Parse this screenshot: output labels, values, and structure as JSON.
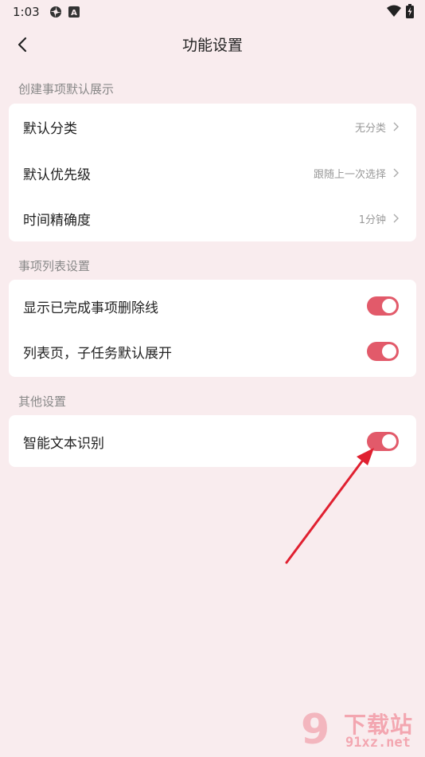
{
  "status_bar": {
    "time": "1:03",
    "icons": [
      "settings-flower-icon",
      "a-badge-icon"
    ],
    "right_icons": [
      "wifi-icon",
      "battery-charging-icon"
    ]
  },
  "header": {
    "title": "功能设置",
    "back_icon": "chevron-left-icon"
  },
  "sections": [
    {
      "label": "创建事项默认展示",
      "rows": [
        {
          "label": "默认分类",
          "value": "无分类"
        },
        {
          "label": "默认优先级",
          "value": "跟随上一次选择"
        },
        {
          "label": "时间精确度",
          "value": "1分钟"
        }
      ]
    },
    {
      "label": "事项列表设置",
      "rows": [
        {
          "label": "显示已完成事项删除线",
          "toggle": true
        },
        {
          "label": "列表页，子任务默认展开",
          "toggle": true
        }
      ]
    },
    {
      "label": "其他设置",
      "rows": [
        {
          "label": "智能文本识别",
          "toggle": true
        }
      ]
    }
  ],
  "colors": {
    "background": "#f9ecee",
    "toggle_on": "#e25a6a",
    "annotation_arrow": "#e02030"
  },
  "watermark": {
    "logo": "9",
    "title": "下载站",
    "domain": "91xz.net"
  }
}
